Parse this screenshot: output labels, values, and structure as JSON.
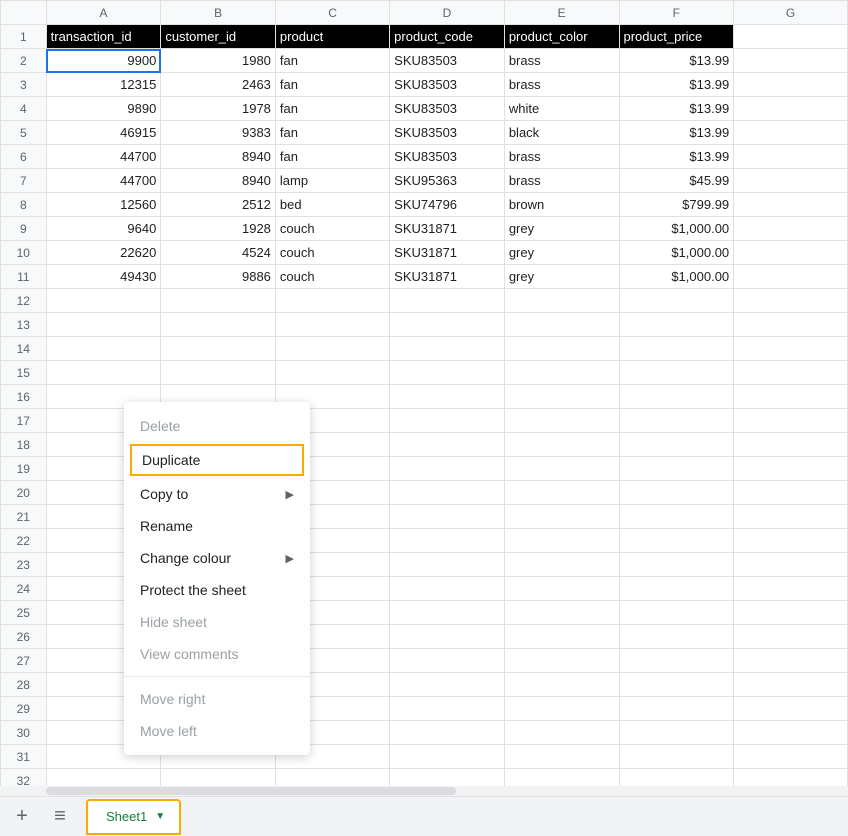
{
  "columns": [
    "A",
    "B",
    "C",
    "D",
    "E",
    "F",
    "G"
  ],
  "row_count": 33,
  "headers": [
    "transaction_id",
    "customer_id",
    "product",
    "product_code",
    "product_color",
    "product_price"
  ],
  "rows": [
    {
      "a": "9900",
      "b": "1980",
      "c": "fan",
      "d": "SKU83503",
      "e": "brass",
      "f": "$13.99"
    },
    {
      "a": "12315",
      "b": "2463",
      "c": "fan",
      "d": "SKU83503",
      "e": "brass",
      "f": "$13.99"
    },
    {
      "a": "9890",
      "b": "1978",
      "c": "fan",
      "d": "SKU83503",
      "e": "white",
      "f": "$13.99"
    },
    {
      "a": "46915",
      "b": "9383",
      "c": "fan",
      "d": "SKU83503",
      "e": "black",
      "f": "$13.99"
    },
    {
      "a": "44700",
      "b": "8940",
      "c": "fan",
      "d": "SKU83503",
      "e": "brass",
      "f": "$13.99"
    },
    {
      "a": "44700",
      "b": "8940",
      "c": "lamp",
      "d": "SKU95363",
      "e": "brass",
      "f": "$45.99"
    },
    {
      "a": "12560",
      "b": "2512",
      "c": "bed",
      "d": "SKU74796",
      "e": "brown",
      "f": "$799.99"
    },
    {
      "a": "9640",
      "b": "1928",
      "c": "couch",
      "d": "SKU31871",
      "e": "grey",
      "f": "$1,000.00"
    },
    {
      "a": "22620",
      "b": "4524",
      "c": "couch",
      "d": "SKU31871",
      "e": "grey",
      "f": "$1,000.00"
    },
    {
      "a": "49430",
      "b": "9886",
      "c": "couch",
      "d": "SKU31871",
      "e": "grey",
      "f": "$1,000.00"
    }
  ],
  "selected_cell": {
    "row": 2,
    "col": "A"
  },
  "sheet_tab": {
    "name": "Sheet1"
  },
  "context_menu": {
    "items": [
      {
        "label": "Delete",
        "disabled": true
      },
      {
        "label": "Duplicate",
        "highlighted": true
      },
      {
        "label": "Copy to",
        "submenu": true
      },
      {
        "label": "Rename"
      },
      {
        "label": "Change colour",
        "submenu": true
      },
      {
        "label": "Protect the sheet"
      },
      {
        "label": "Hide sheet",
        "disabled": true
      },
      {
        "label": "View comments",
        "disabled": true
      },
      {
        "sep": true
      },
      {
        "label": "Move right",
        "disabled": true
      },
      {
        "label": "Move left",
        "disabled": true
      }
    ]
  }
}
